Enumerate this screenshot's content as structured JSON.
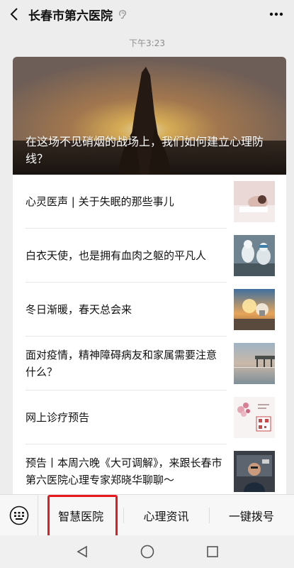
{
  "header": {
    "back_icon": "chevron-left-icon",
    "title": "长春市第六医院",
    "verified_icon": "ear-icon",
    "more_icon": "ellipsis-icon"
  },
  "timestamp": "下午3:23",
  "article_card": {
    "hero": {
      "title": "在这场不见硝烟的战场上，我们如何建立心理防线？",
      "image": "praying-hands-sunset-image"
    },
    "items": [
      {
        "title": "心灵医声 | 关于失眠的那些事儿",
        "thumb": "sleeping-person-image"
      },
      {
        "title": "白衣天使，也是拥有血肉之躯的平凡人",
        "thumb": "medical-staff-image"
      },
      {
        "title": "冬日渐暖，春天总会来",
        "thumb": "lightbulb-sunset-image"
      },
      {
        "title": "面对疫情，精神障碍病友和家属需要注意什么？",
        "thumb": "lake-pier-image"
      },
      {
        "title": "网上诊疗预告",
        "thumb": "flowers-qr-image"
      },
      {
        "title": "预告丨本周六晚《大可调解》，来跟长春市第六医院心理专家郑晓华聊聊～",
        "thumb": "doctor-video-image"
      }
    ]
  },
  "menu": {
    "keyboard_icon": "keyboard-icon",
    "items": [
      "智慧医院",
      "心理资讯",
      "一键拨号"
    ]
  },
  "colors": {
    "background": "#ededed",
    "highlight": "#e8191f",
    "text": "#111111"
  },
  "system_nav": {
    "back_icon": "triangle-back-icon",
    "home_icon": "circle-home-icon",
    "recents_icon": "square-recents-icon"
  }
}
